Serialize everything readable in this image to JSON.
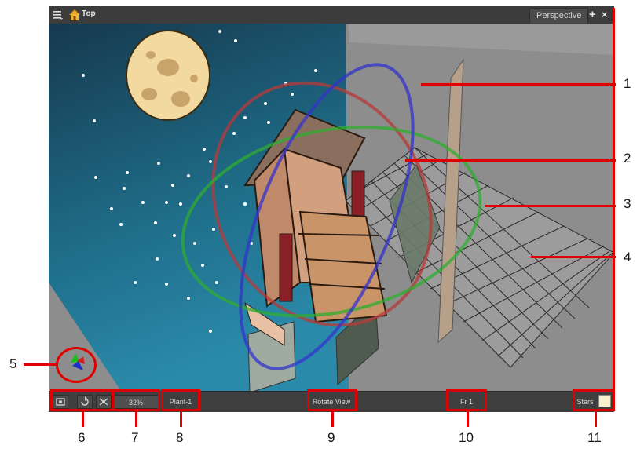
{
  "window": {
    "title": "Top",
    "view_tab": "Perspective",
    "add_label": "+",
    "close_label": "×"
  },
  "statusbar": {
    "zoom": "32%",
    "drawing_name": "Plant-1",
    "rotate_view": "Rotate View",
    "frame": "Fr 1",
    "layer_name": "Stars",
    "layer_color": "#f6f0cc"
  },
  "callouts": {
    "numbers": [
      "1",
      "2",
      "3",
      "4",
      "5",
      "6",
      "7",
      "8",
      "9",
      "10",
      "11"
    ]
  },
  "colors": {
    "accent_red": "#e00000",
    "rotation_red": "#b83a3a",
    "rotation_green": "#2fae2f",
    "rotation_blue": "#3333cc",
    "sky": "#1e5f78",
    "moon": "#f2d9a0"
  },
  "icons": [
    "menu-icon",
    "home-icon",
    "camera-view-icon",
    "reset-rotation-icon",
    "reset-pan-icon",
    "axis-gizmo-icon"
  ]
}
